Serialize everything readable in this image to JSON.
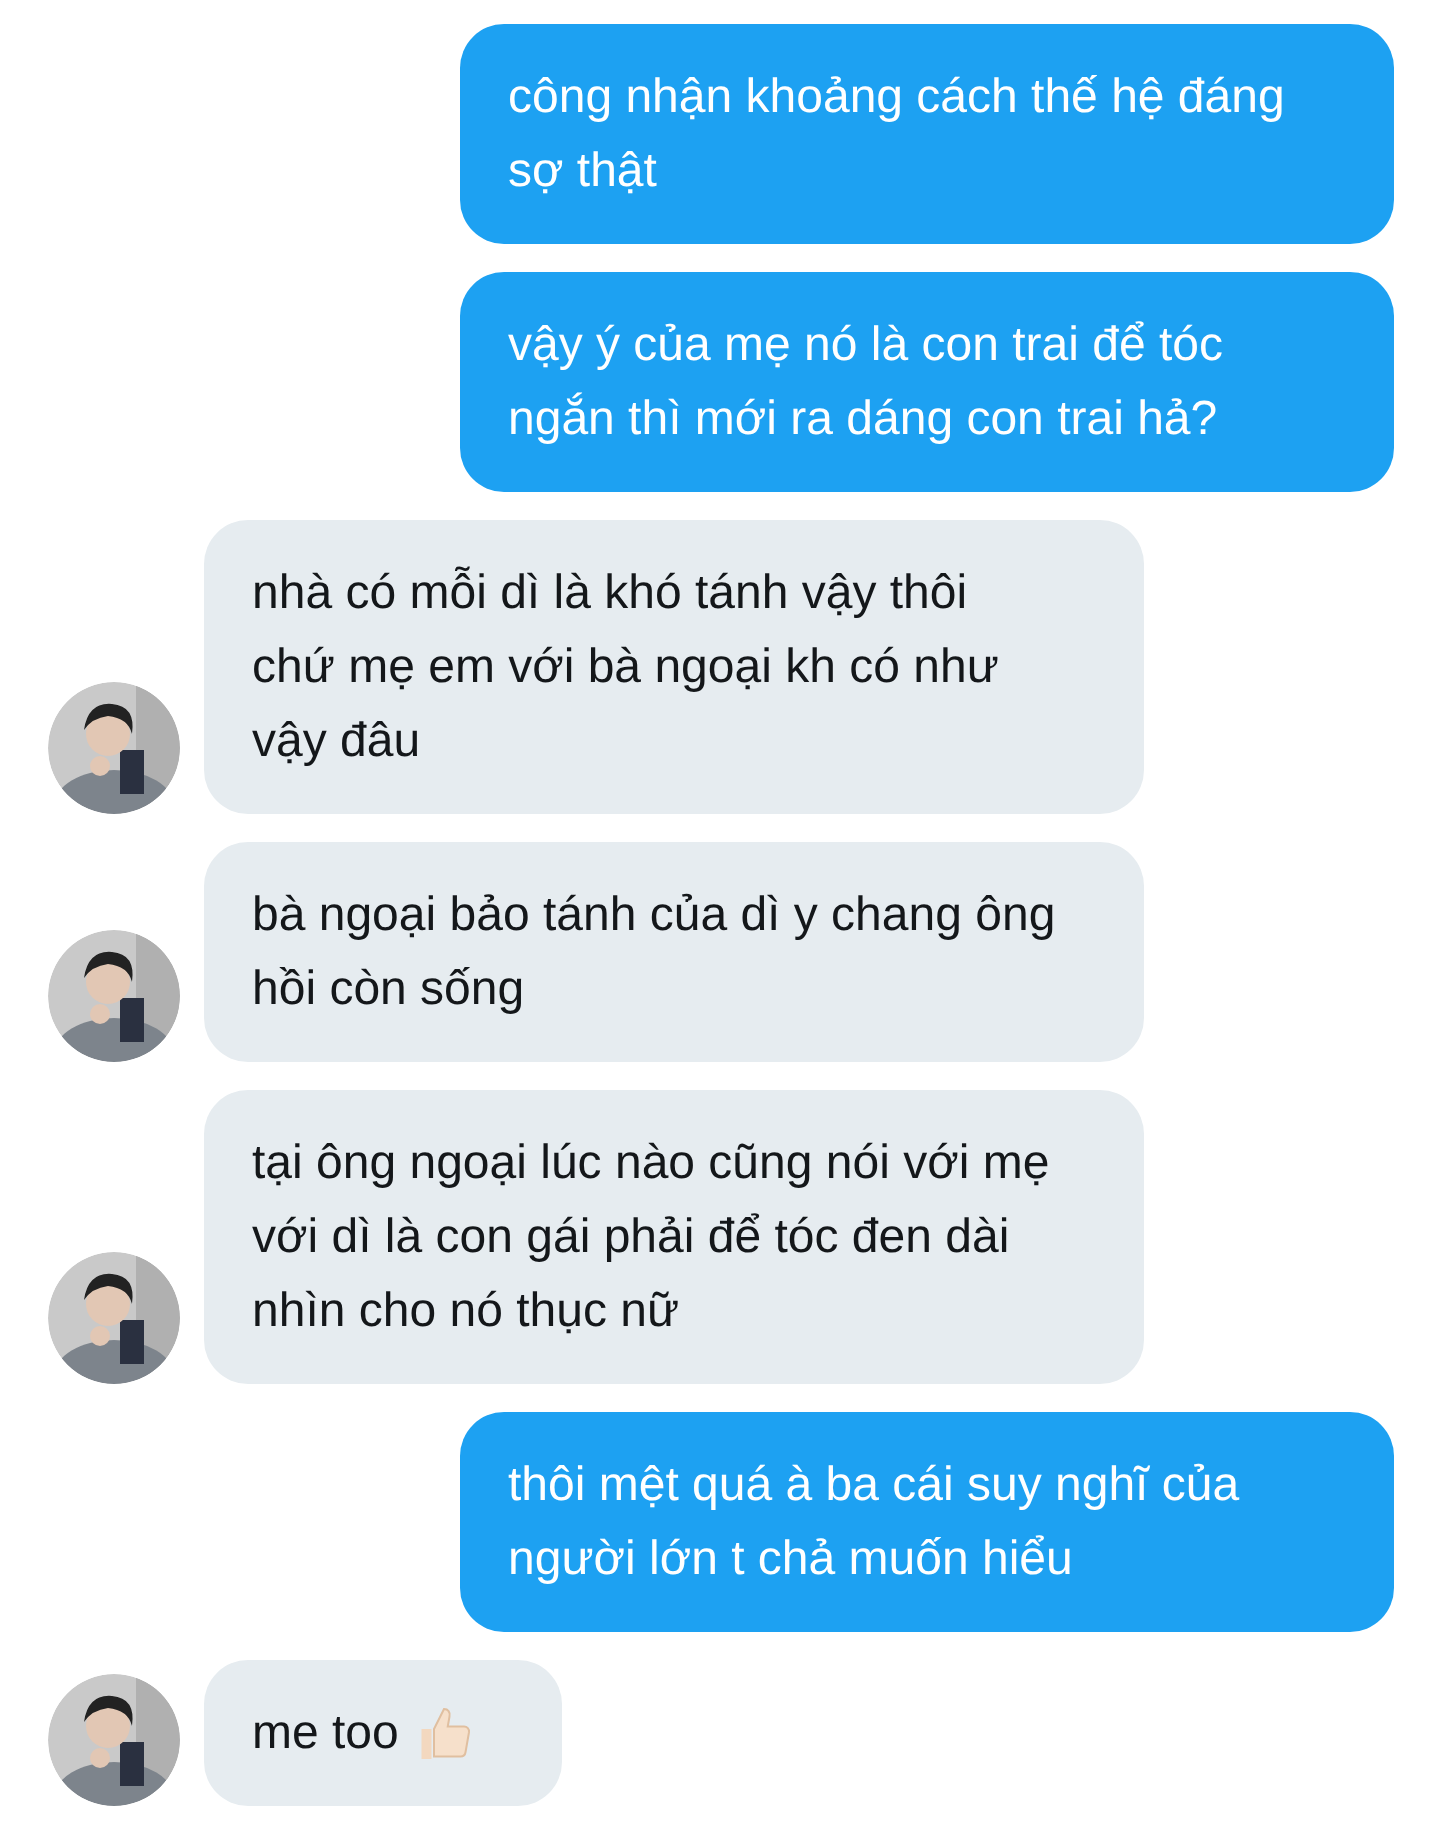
{
  "messages": [
    {
      "kind": "sent",
      "text": "công nhận khoảng cách thế hệ đáng sợ thật"
    },
    {
      "kind": "sent",
      "text": "vậy ý của mẹ nó là con trai để tóc ngắn thì mới ra dáng con trai hả?"
    },
    {
      "kind": "received",
      "text": "nhà có mỗi dì là khó tánh vậy thôi chứ mẹ em với bà ngoại kh có như vậy đâu"
    },
    {
      "kind": "received",
      "text": "bà ngoại bảo tánh của dì y chang ông hồi còn sống"
    },
    {
      "kind": "received",
      "text": "tại ông ngoại lúc nào cũng nói với mẹ với dì là con gái phải để tóc đen dài nhìn cho nó thục nữ"
    },
    {
      "kind": "sent",
      "text": "thôi mệt quá à ba cái suy nghĩ của người lớn t chả muốn hiểu"
    },
    {
      "kind": "received",
      "text": "me too",
      "sticker": {
        "kind": "thumbs-up"
      }
    }
  ]
}
